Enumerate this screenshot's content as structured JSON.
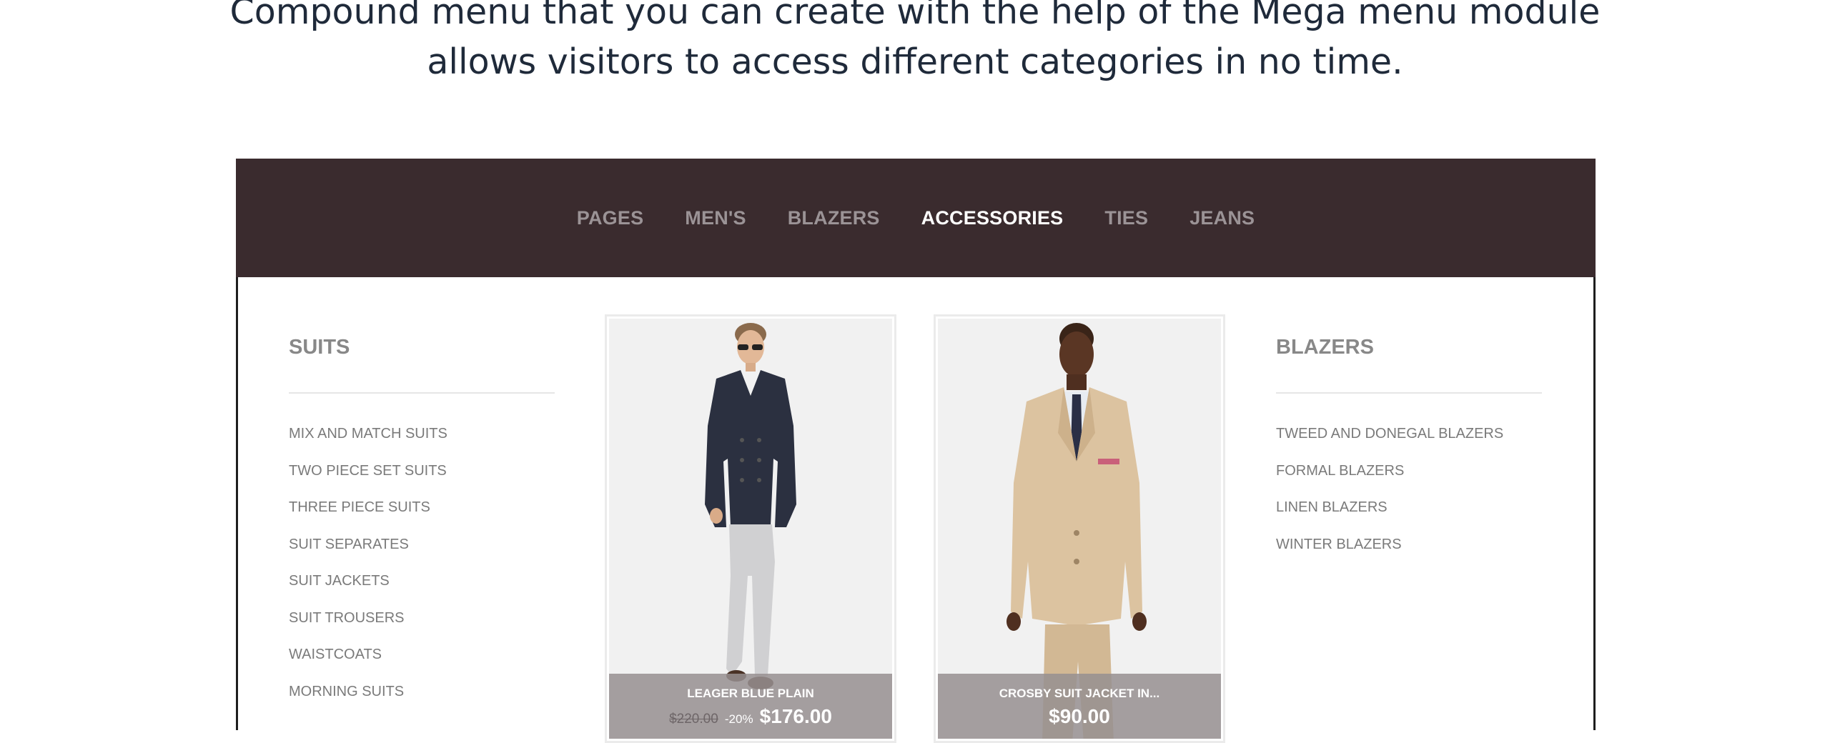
{
  "headline": {
    "line1": "Compound menu that you can create with the help of the Mega menu module",
    "line2": "allows visitors to access different categories in no time."
  },
  "nav": {
    "items": [
      "PAGES",
      "MEN'S",
      "BLAZERS",
      "ACCESSORIES",
      "TIES",
      "JEANS"
    ],
    "active": "ACCESSORIES"
  },
  "suits": {
    "title": "SUITS",
    "items": [
      "MIX AND MATCH SUITS",
      "TWO PIECE SET SUITS",
      "THREE PIECE SUITS",
      "SUIT SEPARATES",
      "SUIT JACKETS",
      "SUIT TROUSERS",
      "WAISTCOATS",
      "MORNING SUITS"
    ]
  },
  "blazers": {
    "title": "BLAZERS",
    "items": [
      "TWEED AND DONEGAL BLAZERS",
      "FORMAL BLAZERS",
      "LINEN BLAZERS",
      "WINTER BLAZERS"
    ]
  },
  "products": [
    {
      "name": "LEAGER BLUE PLAIN",
      "old_price": "$220.00",
      "discount": "-20%",
      "price": "$176.00"
    },
    {
      "name": "CROSBY SUIT JACKET IN...",
      "price": "$90.00"
    }
  ],
  "colors": {
    "menu_bar": "#3a2b2e",
    "nav_active": "#ffffff",
    "nav_inactive": "#9b9396"
  }
}
